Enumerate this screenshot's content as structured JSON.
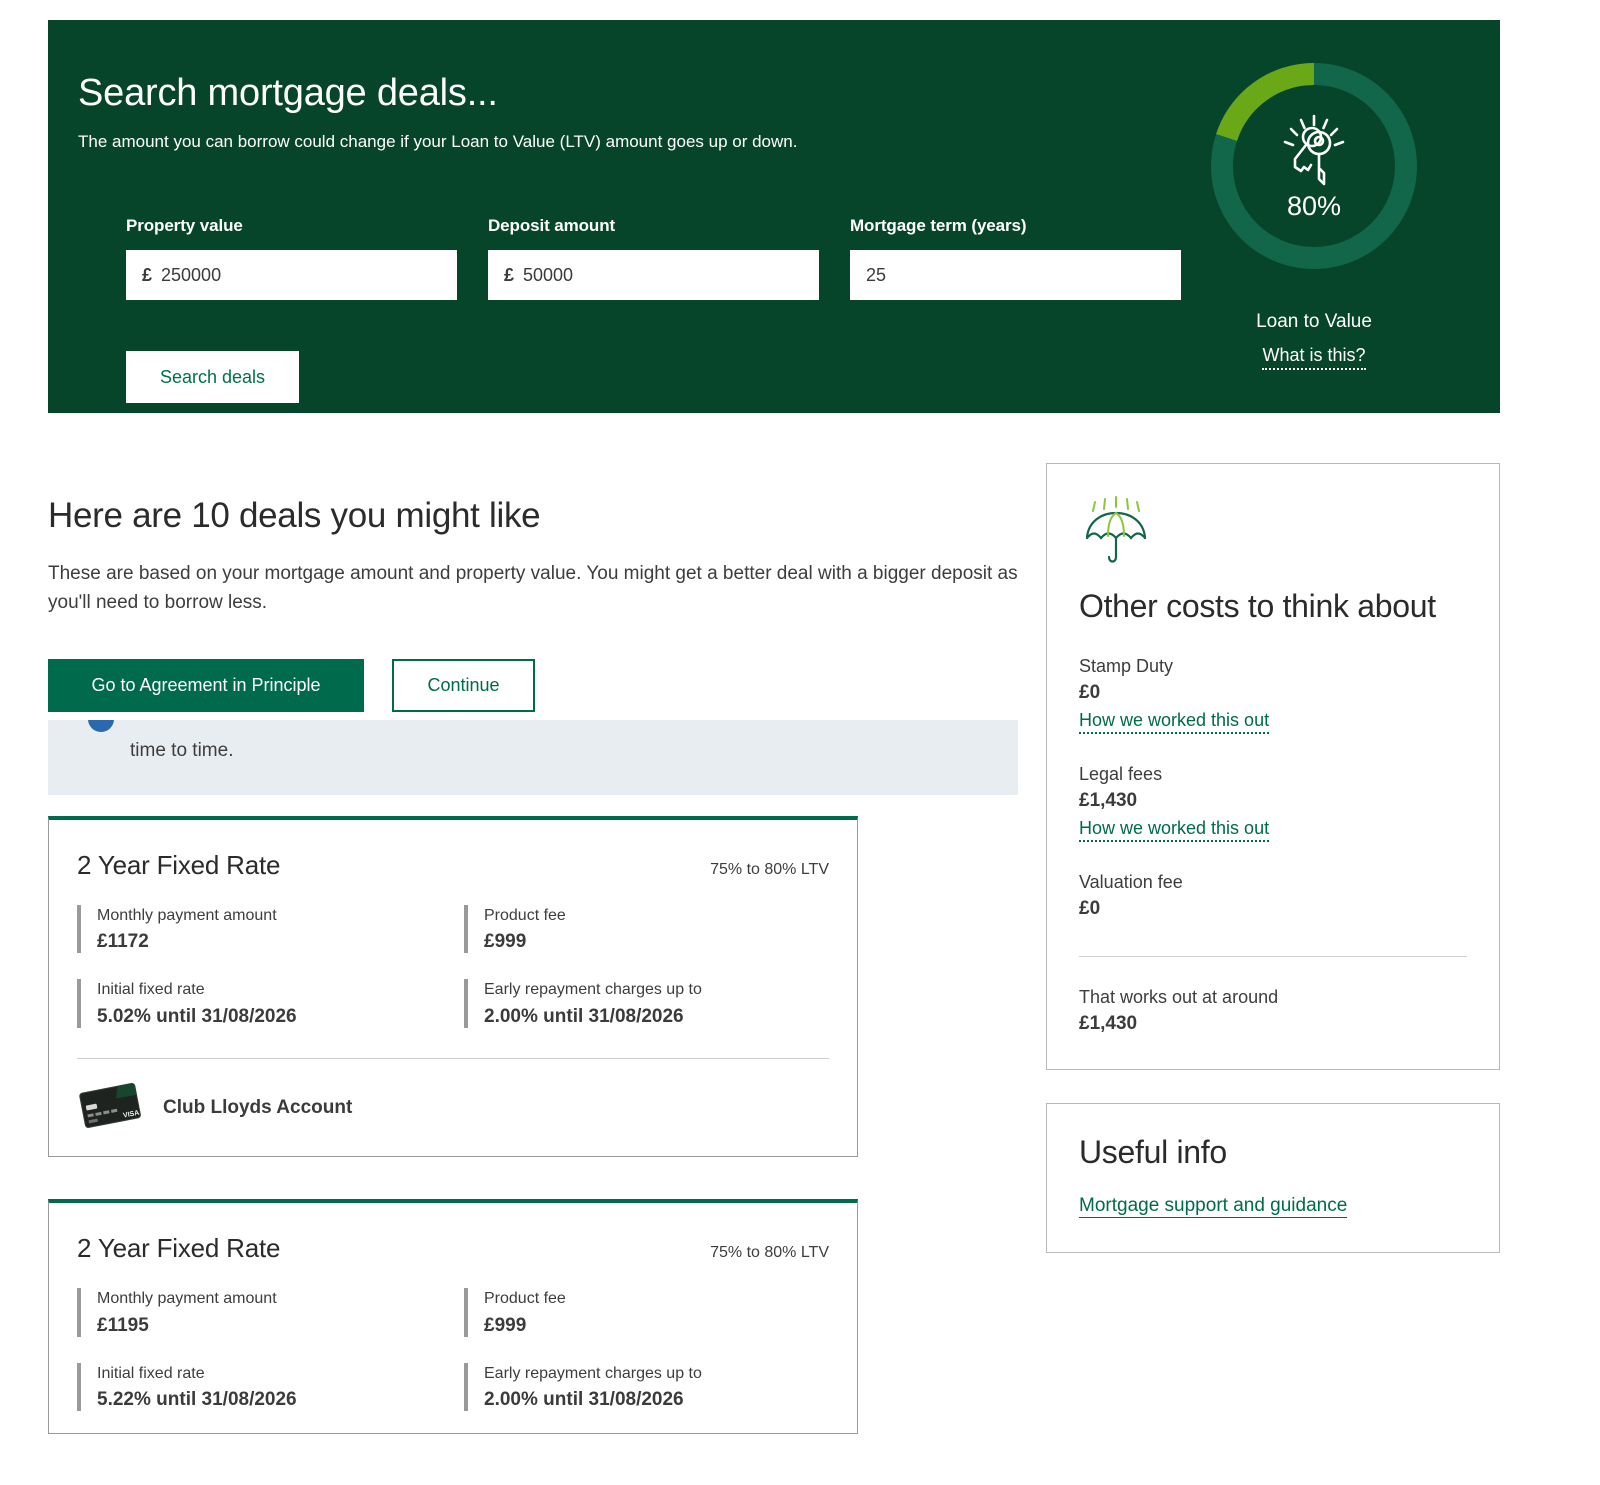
{
  "colors": {
    "hero_green": "#07452a",
    "brand_green": "#006a4d",
    "accent_lime": "#6aa818",
    "donut_track": "#12664a",
    "info_bg": "#e8edf1",
    "text_dark": "#2b2b2b"
  },
  "hero": {
    "title": "Search mortgage deals...",
    "subtitle": "The amount you can borrow could change if your Loan to Value (LTV) amount goes up or down.",
    "fields": [
      {
        "label": "Property value",
        "currency": "£",
        "value": "250000",
        "placeholder": "",
        "name": "property-value"
      },
      {
        "label": "Deposit amount",
        "currency": "£",
        "value": "50000",
        "placeholder": "",
        "name": "deposit-amount"
      },
      {
        "label": "Mortgage term (years)",
        "currency": "",
        "value": "25",
        "placeholder": "",
        "name": "mortgage-term"
      }
    ],
    "search_button": "Search deals",
    "ltv": {
      "percent_label": "80%",
      "percent_value": 80,
      "caption": "Loan to Value",
      "help_link": "What is this?",
      "icon": "keys-icon"
    }
  },
  "main": {
    "heading": "Here are 10 deals you might like",
    "subheading": "These are based on your mortgage amount and property value. You might get a better deal with a bigger deposit as you'll need to borrow less.",
    "primary_button": "Go to Agreement in Principle",
    "secondary_button": "Continue",
    "info_banner": {
      "text": "time to time.",
      "icon": "info-icon"
    },
    "deals": [
      {
        "title": "2 Year Fixed Rate",
        "ltv_range": "75% to 80% LTV",
        "items": [
          {
            "label": "Monthly payment amount",
            "value": "£1172"
          },
          {
            "label": "Product fee",
            "value": "£999"
          },
          {
            "label": "Initial fixed rate",
            "value": "5.02% until 31/08/2026"
          },
          {
            "label": "Early repayment charges up to",
            "value": "2.00% until 31/08/2026"
          }
        ],
        "account": {
          "name": "Club Lloyds Account",
          "icon": "debit-card-icon"
        }
      },
      {
        "title": "2 Year Fixed Rate",
        "ltv_range": "75% to 80% LTV",
        "items": [
          {
            "label": "Monthly payment amount",
            "value": "£1195"
          },
          {
            "label": "Product fee",
            "value": "£999"
          },
          {
            "label": "Initial fixed rate",
            "value": "5.22% until 31/08/2026"
          },
          {
            "label": "Early repayment charges up to",
            "value": "2.00% until 31/08/2026"
          }
        ],
        "account": null
      }
    ]
  },
  "sidebar": {
    "other_costs": {
      "icon": "umbrella-icon",
      "title": "Other costs to think about",
      "rows": [
        {
          "label": "Stamp Duty",
          "value": "£0",
          "link": "How we worked this out"
        },
        {
          "label": "Legal fees",
          "value": "£1,430",
          "link": "How we worked this out"
        },
        {
          "label": "Valuation fee",
          "value": "£0",
          "link": ""
        }
      ],
      "total_label": "That works out at around",
      "total_value": "£1,430"
    },
    "useful_info": {
      "title": "Useful info",
      "link": "Mortgage support and guidance"
    }
  }
}
